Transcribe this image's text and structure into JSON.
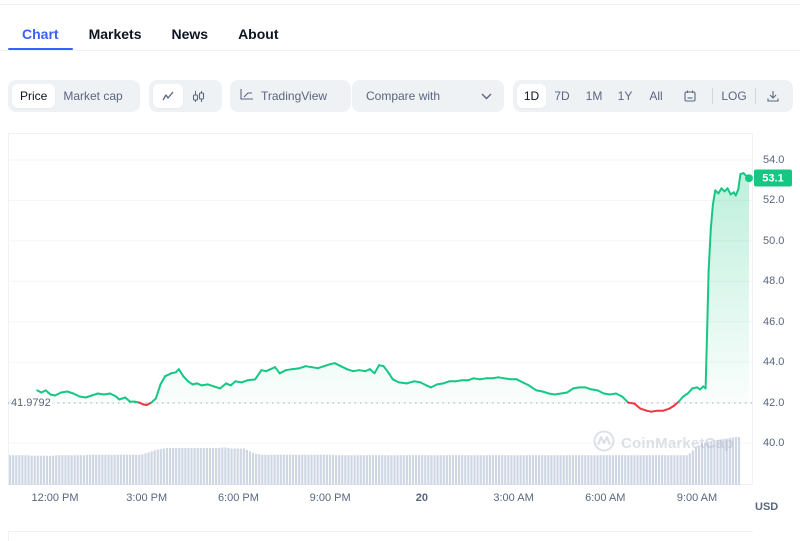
{
  "tabs": [
    {
      "label": "Chart",
      "active": true
    },
    {
      "label": "Markets",
      "active": false
    },
    {
      "label": "News",
      "active": false
    },
    {
      "label": "About",
      "active": false
    }
  ],
  "toolbar": {
    "data_type": {
      "options": [
        "Price",
        "Market cap"
      ],
      "selected": "Price"
    },
    "chart_type": {
      "options": [
        {
          "icon": "line-chart-icon",
          "active": true
        },
        {
          "icon": "candlestick-icon",
          "active": false
        }
      ]
    },
    "tradingview_label": "TradingView",
    "compare_placeholder": "Compare with",
    "ranges": [
      {
        "label": "1D",
        "active": true
      },
      {
        "label": "7D",
        "active": false
      },
      {
        "label": "1M",
        "active": false
      },
      {
        "label": "1Y",
        "active": false
      },
      {
        "label": "All",
        "active": false
      }
    ],
    "calendar_icon": "calendar-icon",
    "log_label": "LOG",
    "download_icon": "download-icon"
  },
  "colors": {
    "accent": "#3861fb",
    "up": "#16c784",
    "down": "#ea3943",
    "volume": "#cfd6e4",
    "axis_text": "#58667e"
  },
  "watermark": "CoinMarketCap",
  "currency_label": "USD",
  "chart_data": {
    "type": "line",
    "title": "",
    "xlabel": "",
    "ylabel": "USD",
    "ylim": [
      38.5,
      55.3
    ],
    "y_ticks": [
      {
        "value": 54.0,
        "label": "54.0"
      },
      {
        "value": 52.0,
        "label": "52.0"
      },
      {
        "value": 50.0,
        "label": "50.0"
      },
      {
        "value": 48.0,
        "label": "48.0"
      },
      {
        "value": 46.0,
        "label": "46.0"
      },
      {
        "value": 44.0,
        "label": "44.0"
      },
      {
        "value": 42.0,
        "label": "42.0"
      },
      {
        "value": 40.0,
        "label": "40.0"
      }
    ],
    "x_range_hours": [
      10.5,
      35.3
    ],
    "x_ticks": [
      {
        "hour": 12,
        "label": "12:00 PM",
        "bold": false
      },
      {
        "hour": 15,
        "label": "3:00 PM",
        "bold": false
      },
      {
        "hour": 18,
        "label": "6:00 PM",
        "bold": false
      },
      {
        "hour": 21,
        "label": "9:00 PM",
        "bold": false
      },
      {
        "hour": 24,
        "label": "20",
        "bold": true
      },
      {
        "hour": 27,
        "label": "3:00 AM",
        "bold": false
      },
      {
        "hour": 30,
        "label": "6:00 AM",
        "bold": false
      },
      {
        "hour": 33,
        "label": "9:00 AM",
        "bold": false
      }
    ],
    "baseline": {
      "value": 41.9792,
      "label": "41.9792"
    },
    "current_price": {
      "value": 53.1,
      "label": "53.1"
    },
    "grid": true,
    "series": [
      {
        "name": "Price",
        "points": [
          [
            11.42,
            42.6
          ],
          [
            11.55,
            42.5
          ],
          [
            11.7,
            42.6
          ],
          [
            11.85,
            42.4
          ],
          [
            12.0,
            42.35
          ],
          [
            12.2,
            42.5
          ],
          [
            12.4,
            42.55
          ],
          [
            12.6,
            42.45
          ],
          [
            12.8,
            42.3
          ],
          [
            13.0,
            42.25
          ],
          [
            13.2,
            42.35
          ],
          [
            13.4,
            42.45
          ],
          [
            13.6,
            42.4
          ],
          [
            13.8,
            42.45
          ],
          [
            14.0,
            42.3
          ],
          [
            14.1,
            42.15
          ],
          [
            14.3,
            42.25
          ],
          [
            14.45,
            42.05
          ],
          [
            14.6,
            42.05
          ],
          [
            14.75,
            42.0
          ],
          [
            14.9,
            41.9
          ],
          [
            15.0,
            41.88
          ],
          [
            15.15,
            42.0
          ],
          [
            15.3,
            42.2
          ],
          [
            15.45,
            42.9
          ],
          [
            15.6,
            43.3
          ],
          [
            15.8,
            43.45
          ],
          [
            15.95,
            43.5
          ],
          [
            16.05,
            43.65
          ],
          [
            16.2,
            43.3
          ],
          [
            16.35,
            43.05
          ],
          [
            16.5,
            42.9
          ],
          [
            16.65,
            42.95
          ],
          [
            16.8,
            42.85
          ],
          [
            17.0,
            42.9
          ],
          [
            17.2,
            42.8
          ],
          [
            17.4,
            42.7
          ],
          [
            17.6,
            42.95
          ],
          [
            17.75,
            42.85
          ],
          [
            17.9,
            43.05
          ],
          [
            18.1,
            43.0
          ],
          [
            18.3,
            43.1
          ],
          [
            18.55,
            43.15
          ],
          [
            18.75,
            43.6
          ],
          [
            18.9,
            43.55
          ],
          [
            19.05,
            43.65
          ],
          [
            19.2,
            43.75
          ],
          [
            19.35,
            43.45
          ],
          [
            19.55,
            43.6
          ],
          [
            19.75,
            43.65
          ],
          [
            20.0,
            43.7
          ],
          [
            20.2,
            43.8
          ],
          [
            20.4,
            43.75
          ],
          [
            20.6,
            43.7
          ],
          [
            20.8,
            43.8
          ],
          [
            21.0,
            43.9
          ],
          [
            21.15,
            43.95
          ],
          [
            21.35,
            43.8
          ],
          [
            21.55,
            43.65
          ],
          [
            21.75,
            43.55
          ],
          [
            21.95,
            43.6
          ],
          [
            22.15,
            43.55
          ],
          [
            22.3,
            43.65
          ],
          [
            22.45,
            43.45
          ],
          [
            22.6,
            43.85
          ],
          [
            22.75,
            43.8
          ],
          [
            22.9,
            43.5
          ],
          [
            23.05,
            43.15
          ],
          [
            23.25,
            43.0
          ],
          [
            23.5,
            42.95
          ],
          [
            23.75,
            43.05
          ],
          [
            23.95,
            43.0
          ],
          [
            24.15,
            42.85
          ],
          [
            24.3,
            42.75
          ],
          [
            24.5,
            42.9
          ],
          [
            24.7,
            42.95
          ],
          [
            24.9,
            43.05
          ],
          [
            25.1,
            43.05
          ],
          [
            25.3,
            43.1
          ],
          [
            25.5,
            43.1
          ],
          [
            25.7,
            43.2
          ],
          [
            25.9,
            43.15
          ],
          [
            26.1,
            43.2
          ],
          [
            26.3,
            43.2
          ],
          [
            26.5,
            43.25
          ],
          [
            26.7,
            43.2
          ],
          [
            26.9,
            43.15
          ],
          [
            27.1,
            43.15
          ],
          [
            27.3,
            43.0
          ],
          [
            27.5,
            42.85
          ],
          [
            27.75,
            42.6
          ],
          [
            27.95,
            42.55
          ],
          [
            28.15,
            42.45
          ],
          [
            28.35,
            42.4
          ],
          [
            28.55,
            42.45
          ],
          [
            28.75,
            42.5
          ],
          [
            28.95,
            42.7
          ],
          [
            29.15,
            42.75
          ],
          [
            29.35,
            42.75
          ],
          [
            29.55,
            42.65
          ],
          [
            29.75,
            42.6
          ],
          [
            29.95,
            42.45
          ],
          [
            30.15,
            42.4
          ],
          [
            30.35,
            42.45
          ],
          [
            30.55,
            42.3
          ],
          [
            30.75,
            42.0
          ],
          [
            30.95,
            41.95
          ],
          [
            31.15,
            41.7
          ],
          [
            31.35,
            41.6
          ],
          [
            31.5,
            41.55
          ],
          [
            31.7,
            41.6
          ],
          [
            31.9,
            41.6
          ],
          [
            32.1,
            41.7
          ],
          [
            32.25,
            41.85
          ],
          [
            32.4,
            42.05
          ],
          [
            32.55,
            42.3
          ],
          [
            32.7,
            42.45
          ],
          [
            32.85,
            42.7
          ],
          [
            33.0,
            42.75
          ],
          [
            33.1,
            42.65
          ],
          [
            33.2,
            42.8
          ],
          [
            33.28,
            42.7
          ],
          [
            33.33,
            45.5
          ],
          [
            33.38,
            48.5
          ],
          [
            33.45,
            50.6
          ],
          [
            33.52,
            51.8
          ],
          [
            33.6,
            52.5
          ],
          [
            33.7,
            52.35
          ],
          [
            33.8,
            52.6
          ],
          [
            33.9,
            52.45
          ],
          [
            34.0,
            52.6
          ],
          [
            34.1,
            52.3
          ],
          [
            34.2,
            52.4
          ],
          [
            34.27,
            52.25
          ],
          [
            34.35,
            52.55
          ],
          [
            34.42,
            53.3
          ],
          [
            34.52,
            53.35
          ],
          [
            34.62,
            53.2
          ],
          [
            34.7,
            53.1
          ]
        ]
      }
    ],
    "volume": {
      "note": "relative volume bar heights (0-1) per time step",
      "values": [
        0.62,
        0.62,
        0.62,
        0.62,
        0.62,
        0.62,
        0.62,
        0.61,
        0.61,
        0.61,
        0.61,
        0.61,
        0.61,
        0.61,
        0.61,
        0.62,
        0.62,
        0.62,
        0.62,
        0.62,
        0.62,
        0.62,
        0.62,
        0.62,
        0.62,
        0.63,
        0.63,
        0.63,
        0.63,
        0.63,
        0.63,
        0.63,
        0.63,
        0.63,
        0.63,
        0.63,
        0.63,
        0.63,
        0.63,
        0.63,
        0.63,
        0.63,
        0.63,
        0.64,
        0.66,
        0.68,
        0.7,
        0.72,
        0.74,
        0.75,
        0.76,
        0.77,
        0.77,
        0.77,
        0.77,
        0.77,
        0.77,
        0.77,
        0.77,
        0.77,
        0.77,
        0.77,
        0.77,
        0.77,
        0.77,
        0.77,
        0.77,
        0.77,
        0.77,
        0.78,
        0.78,
        0.77,
        0.76,
        0.76,
        0.76,
        0.76,
        0.76,
        0.73,
        0.7,
        0.67,
        0.65,
        0.64,
        0.63,
        0.63,
        0.63,
        0.63,
        0.63,
        0.63,
        0.63,
        0.63,
        0.63,
        0.63,
        0.63,
        0.63,
        0.63,
        0.63,
        0.63,
        0.63,
        0.63,
        0.63,
        0.63,
        0.63,
        0.63,
        0.63,
        0.63,
        0.63,
        0.62,
        0.62,
        0.62,
        0.62,
        0.62,
        0.62,
        0.62,
        0.62,
        0.62,
        0.62,
        0.62,
        0.62,
        0.62,
        0.62,
        0.62,
        0.62,
        0.62,
        0.62,
        0.62,
        0.62,
        0.62,
        0.62,
        0.62,
        0.62,
        0.62,
        0.62,
        0.62,
        0.62,
        0.62,
        0.62,
        0.62,
        0.62,
        0.62,
        0.62,
        0.62,
        0.62,
        0.62,
        0.62,
        0.62,
        0.62,
        0.62,
        0.62,
        0.62,
        0.62,
        0.62,
        0.62,
        0.62,
        0.62,
        0.62,
        0.62,
        0.62,
        0.62,
        0.62,
        0.62,
        0.62,
        0.62,
        0.62,
        0.62,
        0.62,
        0.62,
        0.62,
        0.62,
        0.62,
        0.62,
        0.62,
        0.62,
        0.62,
        0.62,
        0.62,
        0.62,
        0.62,
        0.62,
        0.62,
        0.62,
        0.62,
        0.62,
        0.62,
        0.62,
        0.62,
        0.62,
        0.62,
        0.62,
        0.62,
        0.62,
        0.62,
        0.62,
        0.62,
        0.62,
        0.62,
        0.62,
        0.62,
        0.62,
        0.62,
        0.62,
        0.62,
        0.62,
        0.62,
        0.62,
        0.62,
        0.62,
        0.62,
        0.62,
        0.62,
        0.62,
        0.62,
        0.62,
        0.62,
        0.62,
        0.62,
        0.62,
        0.62,
        0.62,
        0.62,
        0.62,
        0.62,
        0.66,
        0.72,
        0.78,
        0.82,
        0.86,
        0.88,
        0.9,
        0.92,
        0.93,
        0.94,
        0.95,
        0.96,
        0.97,
        0.98,
        0.99,
        1.0,
        1.0
      ]
    }
  }
}
